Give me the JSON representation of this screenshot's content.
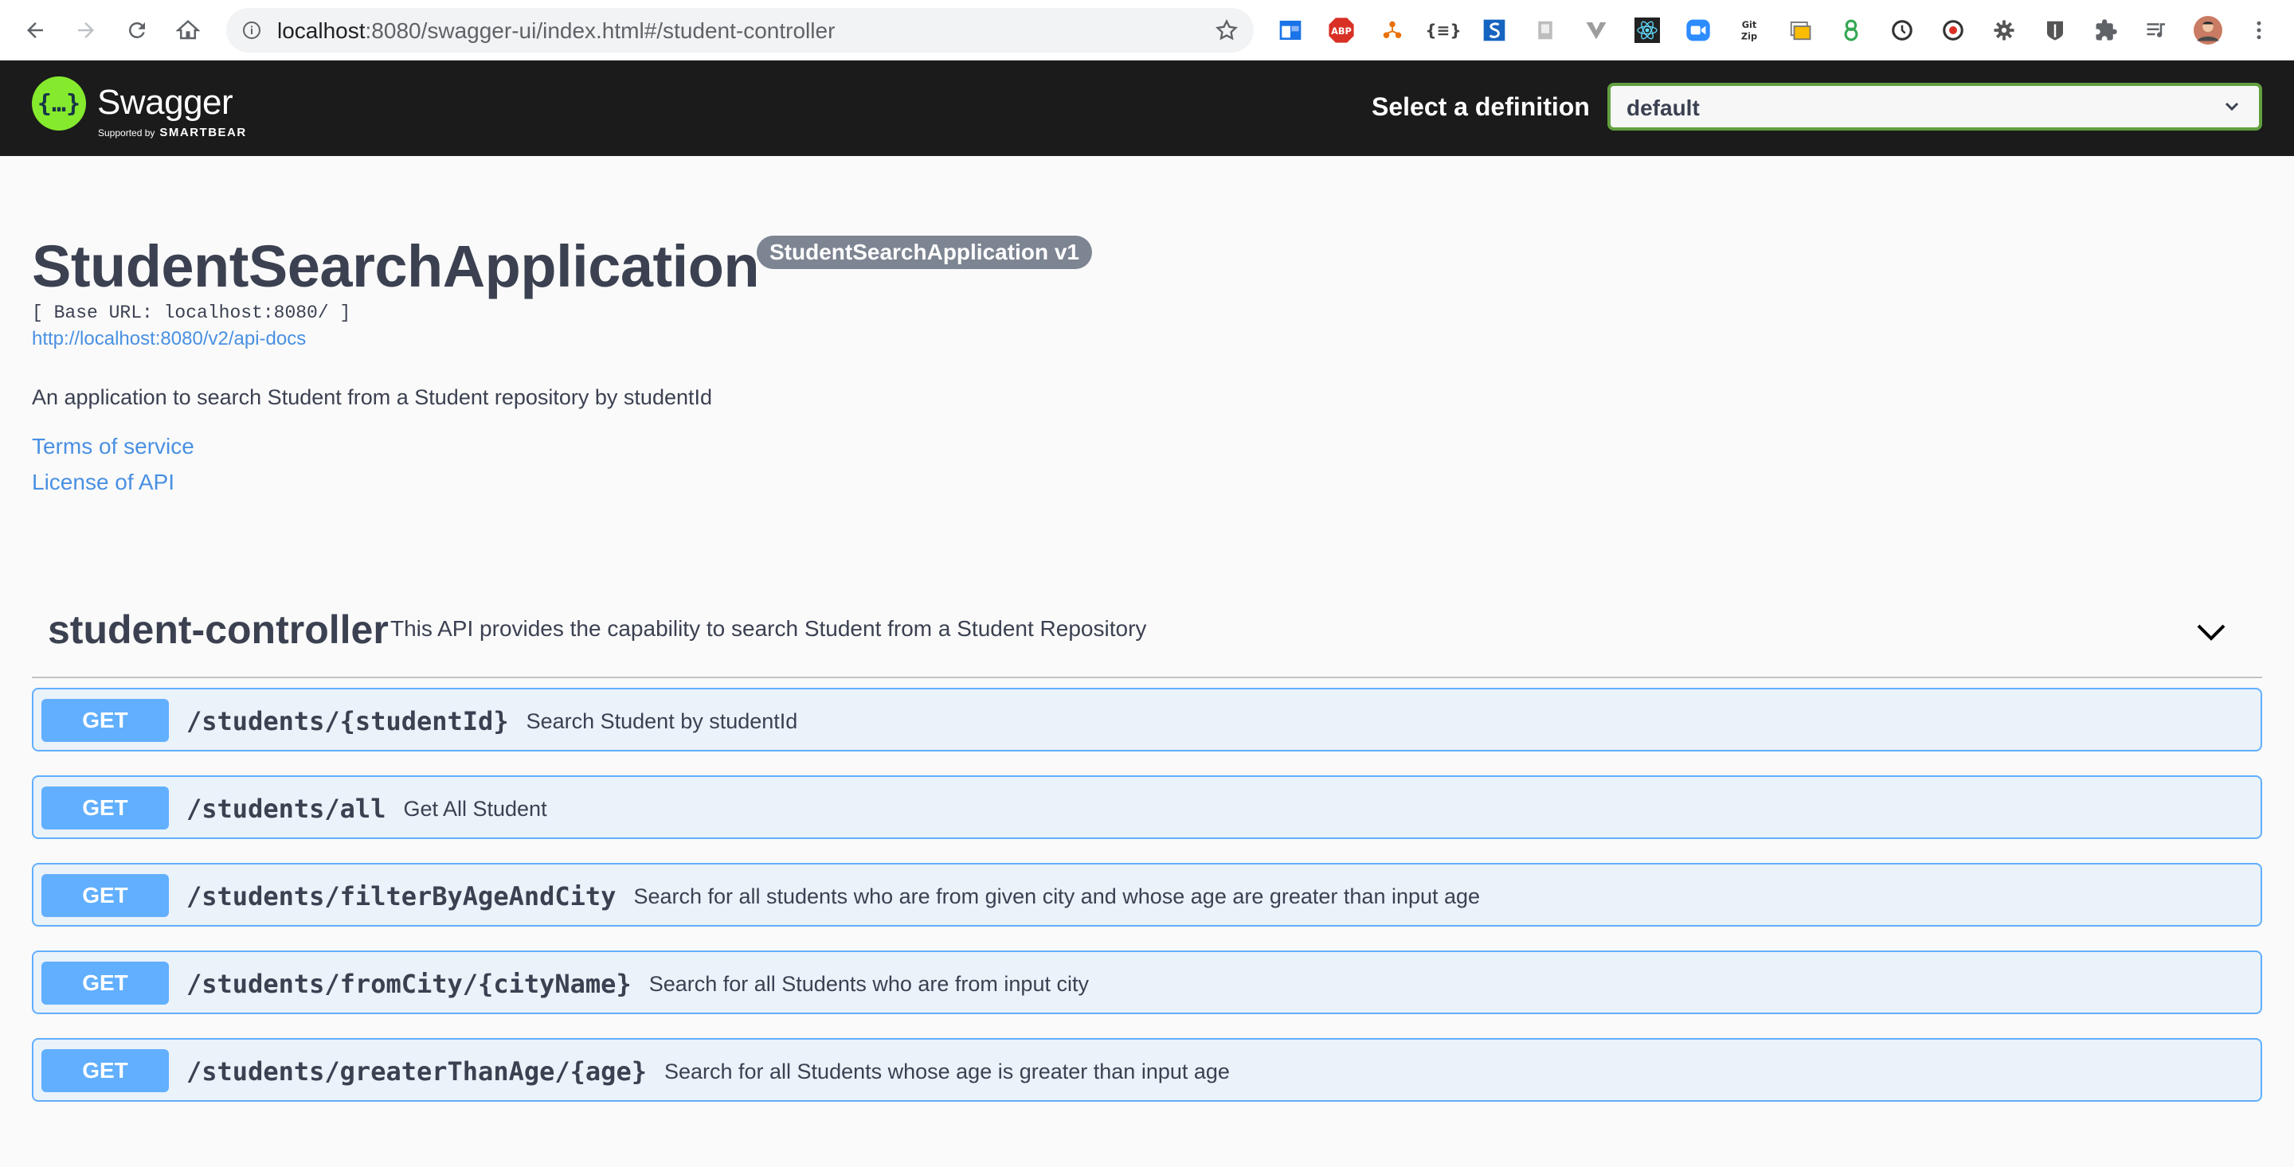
{
  "browser": {
    "url_host": "localhost",
    "url_rest": ":8080/swagger-ui/index.html#/student-controller",
    "extensions": [
      "extension-icon",
      "abp-icon",
      "extension-icon",
      "json-icon",
      "extension-icon",
      "extension-icon",
      "extension-icon",
      "react-icon",
      "zoom-icon",
      "gitzip-icon",
      "extension-icon",
      "extension-icon",
      "extension-icon",
      "extension-icon",
      "gear-icon",
      "extension-icon",
      "puzzle-icon",
      "media-icon",
      "avatar"
    ]
  },
  "topbar": {
    "logo_text": "Swagger",
    "logo_sub": "Supported by",
    "logo_brand": "SMARTBEAR",
    "definition_label": "Select a definition",
    "definition_value": "default",
    "accent": "#85ea2d"
  },
  "info": {
    "title": "StudentSearchApplication",
    "version": "StudentSearchApplication v1",
    "base_url": "[ Base URL: localhost:8080/ ]",
    "api_docs_link": "http://localhost:8080/v2/api-docs",
    "description": "An application to search Student from a Student repository by studentId",
    "terms": "Terms of service",
    "license": "License of API"
  },
  "tag": {
    "name": "student-controller",
    "description": "This API provides the capability to search Student from a Student Repository"
  },
  "operations": [
    {
      "method": "GET",
      "path": "/students/{studentId}",
      "summary": "Search Student by studentId"
    },
    {
      "method": "GET",
      "path": "/students/all",
      "summary": "Get All Student"
    },
    {
      "method": "GET",
      "path": "/students/filterByAgeAndCity",
      "summary": "Search for all students who are from given city and whose age are greater than input age"
    },
    {
      "method": "GET",
      "path": "/students/fromCity/{cityName}",
      "summary": "Search for all Students who are from input city"
    },
    {
      "method": "GET",
      "path": "/students/greaterThanAge/{age}",
      "summary": "Search for all Students whose age is greater than input age"
    }
  ],
  "colors": {
    "get_method": "#61affe",
    "link": "#4990e2",
    "text": "#3b4151"
  }
}
